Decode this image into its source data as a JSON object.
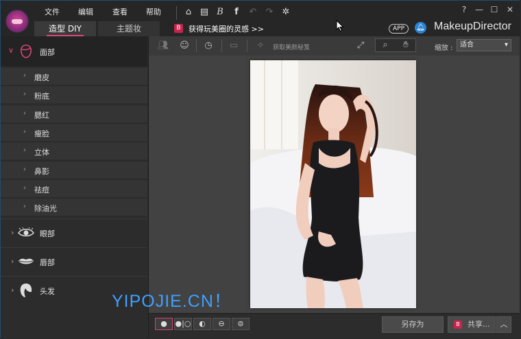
{
  "menu": {
    "file": "文件",
    "edit": "编辑",
    "view": "查看",
    "help": "帮助"
  },
  "tabs": {
    "diy": "造型 DIY",
    "theme": "主题妆"
  },
  "promo": {
    "badge": "B",
    "text": "获得玩美圈的灵感 >>"
  },
  "header_right": {
    "app_badge": "APP",
    "brand": "MakeupDirector"
  },
  "window_controls": {
    "help": "?",
    "minimize": "—",
    "maximize": "☐",
    "close": "✕"
  },
  "sidebar": {
    "face": {
      "label": "面部",
      "chevron": "∨"
    },
    "face_items": [
      "磨皮",
      "粉底",
      "腮红",
      "瘦脸",
      "立体",
      "鼻影",
      "祛痘",
      "除油光"
    ],
    "eyes": {
      "label": "眼部",
      "chevron": "›"
    },
    "lips": {
      "label": "唇部",
      "chevron": "›"
    },
    "hair": {
      "label": "头发",
      "chevron": "›"
    }
  },
  "toolbar": {
    "tip_text": "获取美颜秘笈",
    "zoom_label": "缩放 :",
    "zoom_value": "适合"
  },
  "bottom": {
    "save_label": "另存为",
    "share_badge": "B",
    "share_label": "共享...",
    "more_label": "︿"
  },
  "watermark": "YIPOJIE.CN！",
  "icons": {
    "home": "home-icon",
    "save": "save-icon",
    "brand_b": "b-icon",
    "facebook": "facebook-icon",
    "undo": "undo-icon",
    "redo": "redo-icon",
    "settings": "gear-icon"
  },
  "colors": {
    "accent": "#e0467c",
    "promo": "#c8244e",
    "bell": "#2a84d6",
    "watermark": "#3fa0ff"
  }
}
